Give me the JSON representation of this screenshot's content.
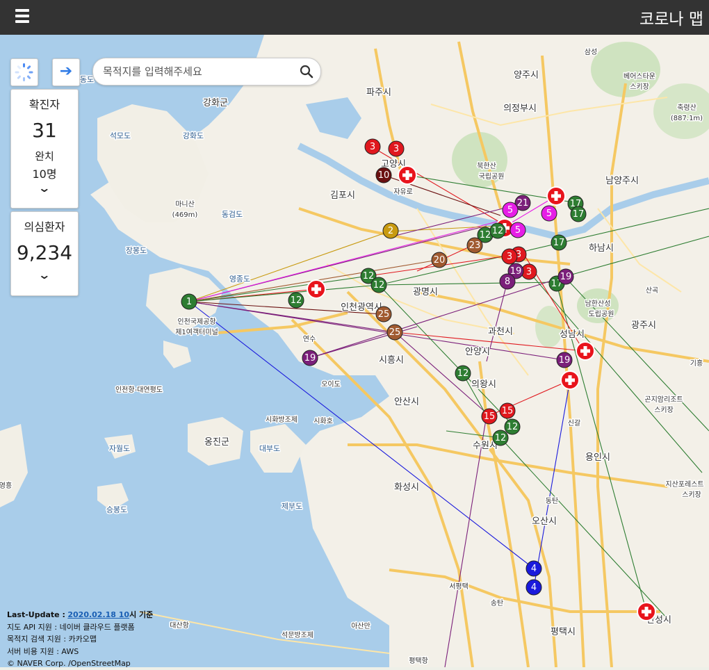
{
  "header": {
    "title": "코로나 맵",
    "menu_icon": "hamburger-icon"
  },
  "search": {
    "placeholder": "목적지를 입력해주세요",
    "go_icon": "arrow-right-icon",
    "search_icon": "magnifier-icon",
    "loading_icon": "spinner-icon"
  },
  "stats": {
    "confirmed_label": "확진자",
    "confirmed_value": "31",
    "recovered_label": "완치",
    "recovered_value": "10명",
    "suspected_label": "의심환자",
    "suspected_value": "9,234",
    "expand_icon": "chevron-down-icon"
  },
  "footer": {
    "update_label": "Last-Update :",
    "update_value": "2020.02.18 10",
    "update_suffix": "시 기준",
    "line1": "지도 API 지원 : 네이버 클라우드 플랫폼",
    "line2": "목적지 검색 지원 : 카카오맵",
    "line3": "서버 비용 지원 : AWS",
    "line4": "© NAVER Corp. /OpenStreetMap"
  },
  "place_labels": [
    "강화군",
    "파주시",
    "양주시",
    "의정부시",
    "남양주시",
    "김포시",
    "고양시",
    "자유로",
    "인천광역시",
    "광명시",
    "과천시",
    "하남시",
    "광주시",
    "성남시",
    "안양시",
    "시흥시",
    "의왕시",
    "안산시",
    "수원시",
    "화성시",
    "용인시",
    "오산시",
    "평택시",
    "안성시",
    "옹진군",
    "인천국제공항 제1여객터미널",
    "마니산 (469m)",
    "축령산 (887.1m)",
    "북한산 국립공원",
    "남한산성 도립공원",
    "영종도",
    "장봉도",
    "자월도",
    "승봉도",
    "제부도",
    "대부도",
    "시화방조제",
    "석문방조제",
    "대산항",
    "아산만",
    "평택항",
    "석모도",
    "교동도",
    "강화도",
    "동검도",
    "연수",
    "신갈",
    "동탄",
    "송탄",
    "서평택",
    "오이도",
    "인천항-대연평도",
    "곤지암리조트 스키장",
    "지산포레스트 스키장",
    "베어스타운 스키장",
    "산곡",
    "기흥",
    "영흥",
    "시화호",
    "삼성"
  ],
  "colors": {
    "hospital": "#e8141c",
    "green": "#2e7d32",
    "purple": "#7b1f7a",
    "magenta": "#e61ee6",
    "red": "#e0181e",
    "darkred": "#6b1010",
    "blue": "#1a1adc",
    "brown": "#a05a30",
    "olive": "#c89a10"
  },
  "markers": [
    "1",
    "3",
    "3",
    "10",
    "21",
    "5",
    "5",
    "5",
    "17",
    "17",
    "17",
    "17",
    "2",
    "12",
    "12",
    "23",
    "3",
    "3",
    "3",
    "19",
    "19",
    "8",
    "20",
    "12",
    "12",
    "12",
    "25",
    "25",
    "19",
    "12",
    "15",
    "15",
    "12",
    "12",
    "4",
    "4",
    "19"
  ]
}
